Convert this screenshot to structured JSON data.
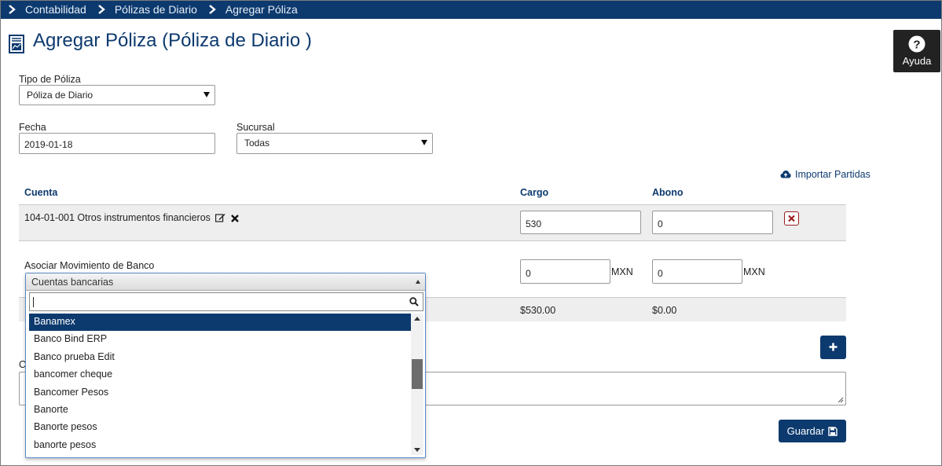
{
  "breadcrumb": [
    "Contabilidad",
    "Pólizas de Diario",
    "Agregar Póliza"
  ],
  "page": {
    "title": "Agregar Póliza (Póliza de Diario )"
  },
  "help": {
    "label": "Ayuda"
  },
  "form": {
    "tipo_label": "Tipo de Póliza",
    "tipo_value": "Póliza de Diario",
    "fecha_label": "Fecha",
    "fecha_value": "2019-01-18",
    "sucursal_label": "Sucursal",
    "sucursal_value": "Todas"
  },
  "import_label": "Importar Partidas",
  "table": {
    "headers": {
      "cuenta": "Cuenta",
      "cargo": "Cargo",
      "abono": "Abono"
    },
    "row": {
      "account": "104-01-001 Otros instrumentos financieros",
      "cargo": "530",
      "abono": "0"
    },
    "bank": {
      "label": "Asociar Movimiento de Banco",
      "cargo": "0",
      "abono": "0",
      "currency": "MXN"
    },
    "totals": {
      "cargo": "$530.00",
      "abono": "$0.00"
    }
  },
  "concepto_label": "C",
  "save_label": "Guardar",
  "dropdown": {
    "header": "Cuentas bancarias",
    "search_value": "",
    "items": [
      "Banamex",
      "Banco Bind ERP",
      "Banco prueba Edit",
      "bancomer cheque",
      "Bancomer Pesos",
      "Banorte",
      "Banorte pesos",
      "banorte pesos"
    ],
    "selected": "Banamex"
  },
  "colors": {
    "primary": "#0d3a6e",
    "danger": "#9c1a1a",
    "row_bg": "#eeeeee"
  }
}
